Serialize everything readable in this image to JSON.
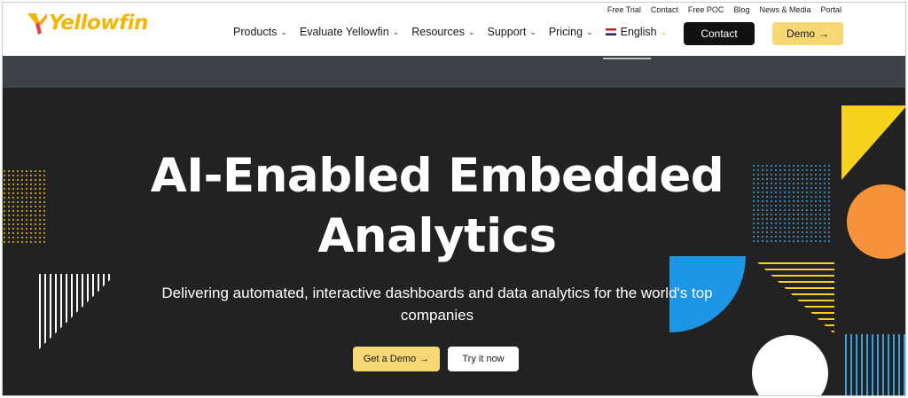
{
  "brand": {
    "logo_text": "Yellowfin",
    "accent": "#f2b705",
    "dark": "#222222"
  },
  "utility_nav": [
    "Free Trial",
    "Contact",
    "Free POC",
    "Blog",
    "News & Media",
    "Portal"
  ],
  "main_nav": [
    {
      "label": "Products"
    },
    {
      "label": "Evaluate Yellowfin"
    },
    {
      "label": "Resources"
    },
    {
      "label": "Support"
    },
    {
      "label": "Pricing"
    }
  ],
  "language": {
    "label": "English"
  },
  "header_buttons": {
    "contact": "Contact",
    "demo": "Demo",
    "demo_arrow": "→"
  },
  "hero": {
    "title_line1": "AI-Enabled Embedded",
    "title_line2": "Analytics",
    "subtitle": "Delivering automated, interactive dashboards and data analytics for the world's top companies",
    "cta_primary": "Get a Demo",
    "cta_primary_arrow": "→",
    "cta_secondary": "Try it now"
  },
  "icons": {
    "chevron": "⌄"
  }
}
